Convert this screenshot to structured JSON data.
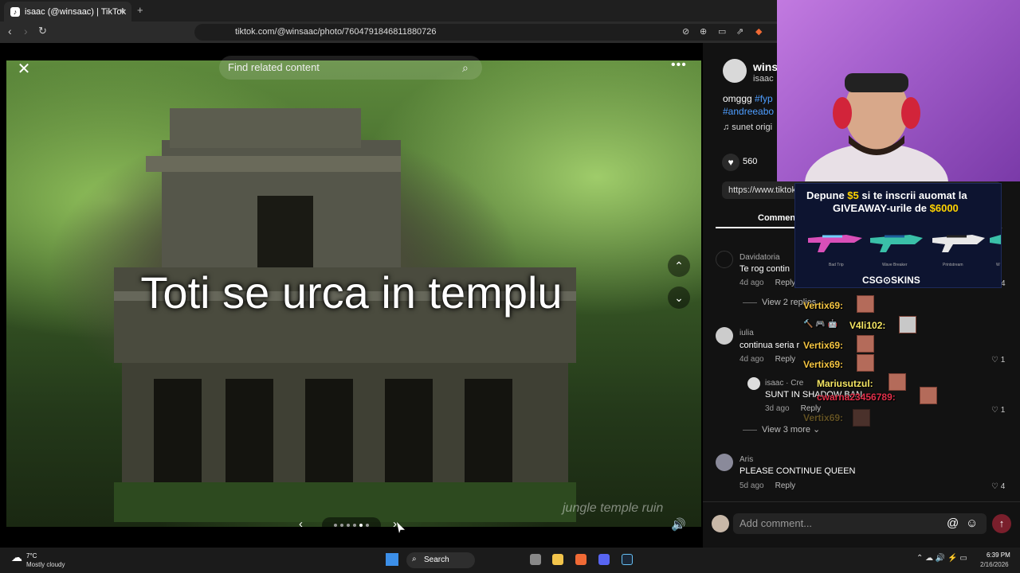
{
  "browser": {
    "tab_title": "isaac (@winsaac) | TikTok",
    "tab_icon": "tiktok-icon",
    "new_tab": "+",
    "close_tab": "×",
    "url": "tiktok.com/@winsaac/photo/7604791846811880726"
  },
  "viewer": {
    "close": "✕",
    "search_placeholder": "Find related content",
    "more": "•••",
    "caption": "Toti se urca in templu",
    "watermark": "jungle temple ruin",
    "prev": "‹",
    "next": "›",
    "up": "⌃",
    "down": "⌄",
    "volume": "🔊",
    "slides_total": 6,
    "slide_active": 5
  },
  "post": {
    "author_name": "wins",
    "author_handle": "isaac ·",
    "description_prefix": "omggg ",
    "description_tag1": "#fyp",
    "description_tag2": "#andreeabo",
    "music": "♫  sunet origi",
    "likes": "560",
    "link": "https://www.tiktok",
    "comments_tab": "Comment"
  },
  "comments": [
    {
      "user": "Davidatoria",
      "text": "Te rog contin",
      "time": "4d ago",
      "reply": "Reply",
      "likes": "4",
      "replies_label": "View 2 replies"
    },
    {
      "user": "iulia",
      "text": "continua seria r",
      "time": "4d ago",
      "reply": "Reply",
      "likes": "1"
    },
    {
      "user": "isaac · Cre",
      "text": "SUNT IN SHADOW BAN",
      "time": "3d ago",
      "reply": "Reply",
      "likes": "1",
      "replies_label": "View 3 more ⌄"
    },
    {
      "user": "Aris",
      "text": "PLEASE CONTINUE QUEEN",
      "time": "5d ago",
      "reply": "Reply",
      "likes": "4"
    }
  ],
  "comment_bar": {
    "placeholder": "Add comment...",
    "at": "@",
    "emoji": "☺",
    "send": "↑"
  },
  "overlay_ad": {
    "line1_a": "Depune ",
    "line1_b": "$5",
    "line1_c": " si te inscrii auomat la",
    "line2_a": "GIVEAWAY-urile de ",
    "line2_b": "$6000",
    "guns": [
      "Bad Trip",
      "Wave Breaker",
      "Printstream",
      "W"
    ],
    "brand": "CSG⊙SKINS"
  },
  "stream_chat": [
    {
      "name": "Vertix69:",
      "color": "#f5c542"
    },
    {
      "name": "V4li102:",
      "color": "#f5e663"
    },
    {
      "name": "Vertix69:",
      "color": "#f5c542"
    },
    {
      "name": "Vertix69:",
      "color": "#f5c542"
    },
    {
      "name": "Mariusutzul:",
      "color": "#f5e663"
    },
    {
      "name": "cwarna23456789:",
      "color": "#e0304a"
    },
    {
      "name": "Vertix69:",
      "color": "#f5c542"
    }
  ],
  "taskbar": {
    "temp": "7°C",
    "weather": "Mostly cloudy",
    "search": "Search",
    "time": "6:39 PM",
    "date": "2/16/2026"
  },
  "colors": {
    "accent": "#4d9dff",
    "send": "#7a1f2c",
    "ad_highlight": "#ffd400"
  }
}
